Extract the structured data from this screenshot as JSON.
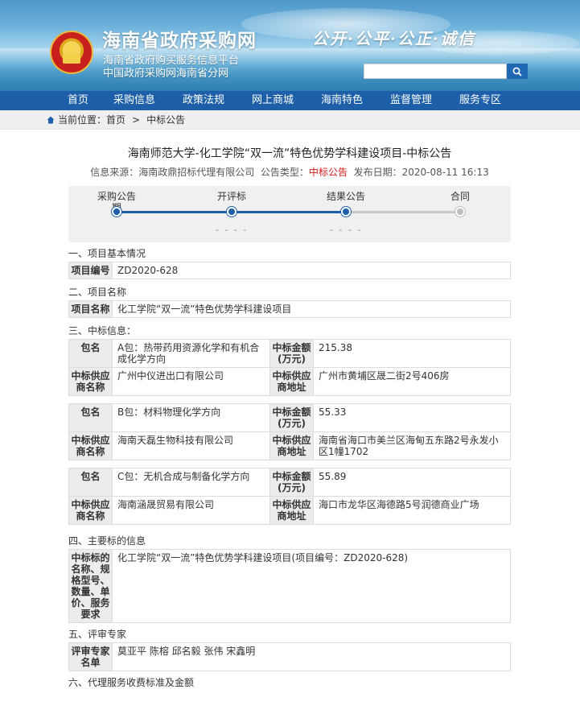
{
  "header": {
    "site_title": "海南省政府采购网",
    "subtitle_1": "海南省政府购买服务信息平台",
    "subtitle_2": "中国政府采购网海南省分网",
    "slogan": "公开·公平·公正·诚信",
    "search_placeholder": ""
  },
  "nav": {
    "items": [
      "首页",
      "采购信息",
      "政策法规",
      "网上商城",
      "海南特色",
      "监督管理",
      "服务专区"
    ]
  },
  "breadcrumb": {
    "prefix": "当前位置：首页",
    "separator": ">",
    "current": "中标公告"
  },
  "article": {
    "title": "海南师范大学-化工学院“双一流”特色优势学科建设项目-中标公告",
    "meta_source": "信息来源：海南政鼎招标代理有限公司",
    "meta_type_label": "公告类型：",
    "meta_type_value": "中标公告",
    "meta_date": "发布日期：2020-08-11 16:13"
  },
  "progress": {
    "steps": [
      "采购公告",
      "开评标",
      "结果公告",
      "合同"
    ],
    "step1_extra": "期",
    "dashes": "- - - -",
    "completed_fraction": 0.67
  },
  "section1": {
    "title": "一、项目基本情况",
    "label": "项目编号",
    "value": "ZD2020-628"
  },
  "section2": {
    "title": "二、项目名称",
    "label": "项目名称",
    "value": "化工学院“双一流”特色优势学科建设项目"
  },
  "section3": {
    "title": "三、中标信息：",
    "label_package": "包名",
    "label_amount": "中标金额(万元)",
    "label_supplier": "中标供应商名称",
    "label_address": "中标供应商地址",
    "packages": [
      {
        "name": "A包：热带药用资源化学和有机合成化学方向",
        "amount": "215.38",
        "supplier": "广州中仪进出口有限公司",
        "address": "广州市黄埔区晟二街2号406房"
      },
      {
        "name": "B包：材料物理化学方向",
        "amount": "55.33",
        "supplier": "海南天磊生物科技有限公司",
        "address": "海南省海口市美兰区海甸五东路2号永发小区1幢1702"
      },
      {
        "name": "C包：无机合成与制备化学方向",
        "amount": "55.89",
        "supplier": "海南涵晟贸易有限公司",
        "address": "海口市龙华区海德路5号润德商业广场"
      }
    ]
  },
  "section4": {
    "title": "四、主要标的信息",
    "label": "中标标的名称、规格型号、数量、单价、服务要求",
    "value": "化工学院“双一流”特色优势学科建设项目(项目编号：ZD2020-628)"
  },
  "section5": {
    "title": "五、评审专家",
    "label": "评审专家名单",
    "value": "莫亚平 陈榕 邱名毅 张伟 宋鑫明"
  },
  "section6": {
    "title": "六、代理服务收费标准及金额"
  },
  "colors": {
    "nav_blue": "#1d5fa8",
    "accent_red": "#d41a1a"
  }
}
